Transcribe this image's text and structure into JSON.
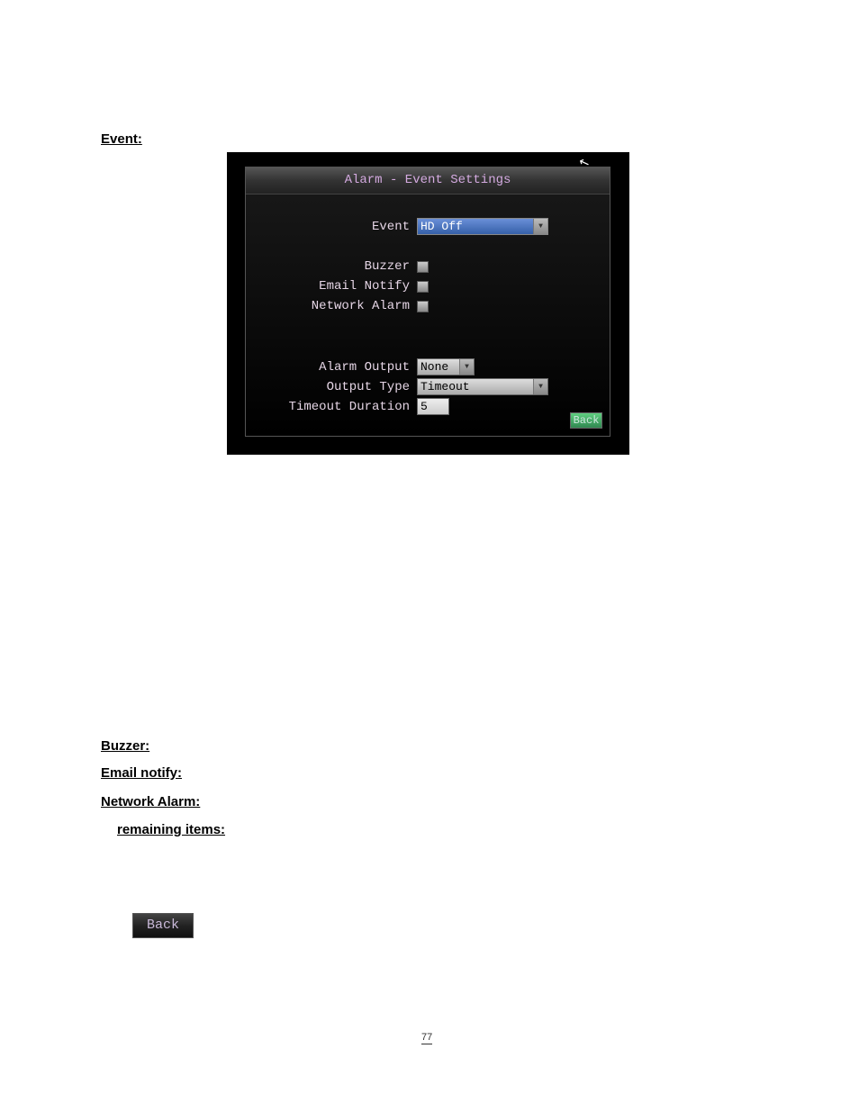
{
  "section_headings": {
    "event": "Event:",
    "buzzer": "Buzzer:",
    "email": "Email notify:",
    "network": "Network Alarm:",
    "remaining": "remaining items:"
  },
  "dialog": {
    "title": "Alarm - Event Settings",
    "rows": {
      "event_label": "Event",
      "event_value": "HD Off",
      "buzzer_label": "Buzzer",
      "email_label": "Email Notify",
      "network_label": "Network Alarm",
      "alarm_output_label": "Alarm Output",
      "alarm_output_value": "None",
      "output_type_label": "Output Type",
      "output_type_value": "Timeout",
      "timeout_duration_label": "Timeout Duration",
      "timeout_duration_value": "5"
    },
    "back": "Back"
  },
  "standalone_back": "Back",
  "page_number": "77"
}
